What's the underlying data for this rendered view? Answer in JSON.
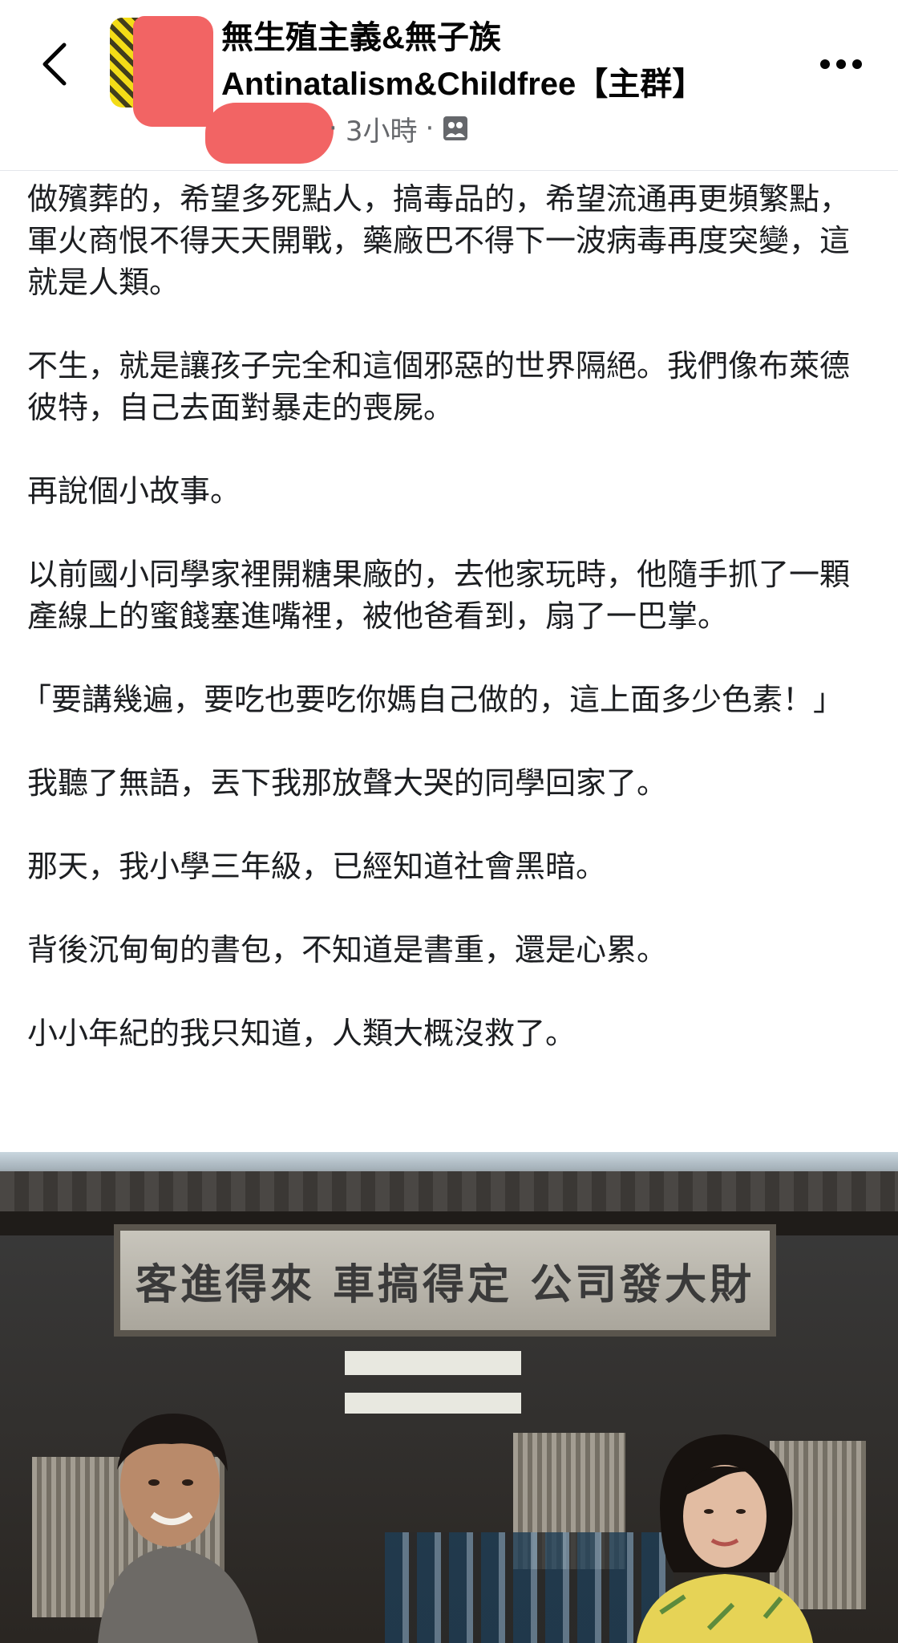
{
  "header": {
    "group_name": "無生殖主義&無子族 Antinatalism&Childfree【主群】",
    "timestamp": "3小時",
    "separator": "·",
    "audience_icon": "group-audience-icon",
    "back_icon": "chevron-left-icon",
    "more_icon": "more-horizontal-icon"
  },
  "post": {
    "paragraphs": [
      "做殯葬的，希望多死點人，搞毒品的，希望流通再更頻繁點，軍火商恨不得天天開戰，藥廠巴不得下一波病毒再度突變，這就是人類。",
      "不生，就是讓孩子完全和這個邪惡的世界隔絕。我們像布萊德彼特，自己去面對暴走的喪屍。",
      "再說個小故事。",
      "以前國小同學家裡開糖果廠的，去他家玩時，他隨手抓了一顆產線上的蜜餞塞進嘴裡，被他爸看到，扇了一巴掌。",
      "「要講幾遍，要吃也要吃你媽自己做的，這上面多少色素！」",
      "我聽了無語，丟下我那放聲大哭的同學回家了。",
      "那天，我小學三年級，已經知道社會黑暗。",
      "背後沉甸甸的書包，不知道是書重，還是心累。",
      "小小年紀的我只知道，人類大概沒救了。"
    ]
  },
  "image": {
    "sign_text": "客進得來 車搞得定 公司發大財"
  },
  "colors": {
    "redaction": "#f26464",
    "meta_text": "#65676b",
    "body_text": "#1c1e21"
  }
}
